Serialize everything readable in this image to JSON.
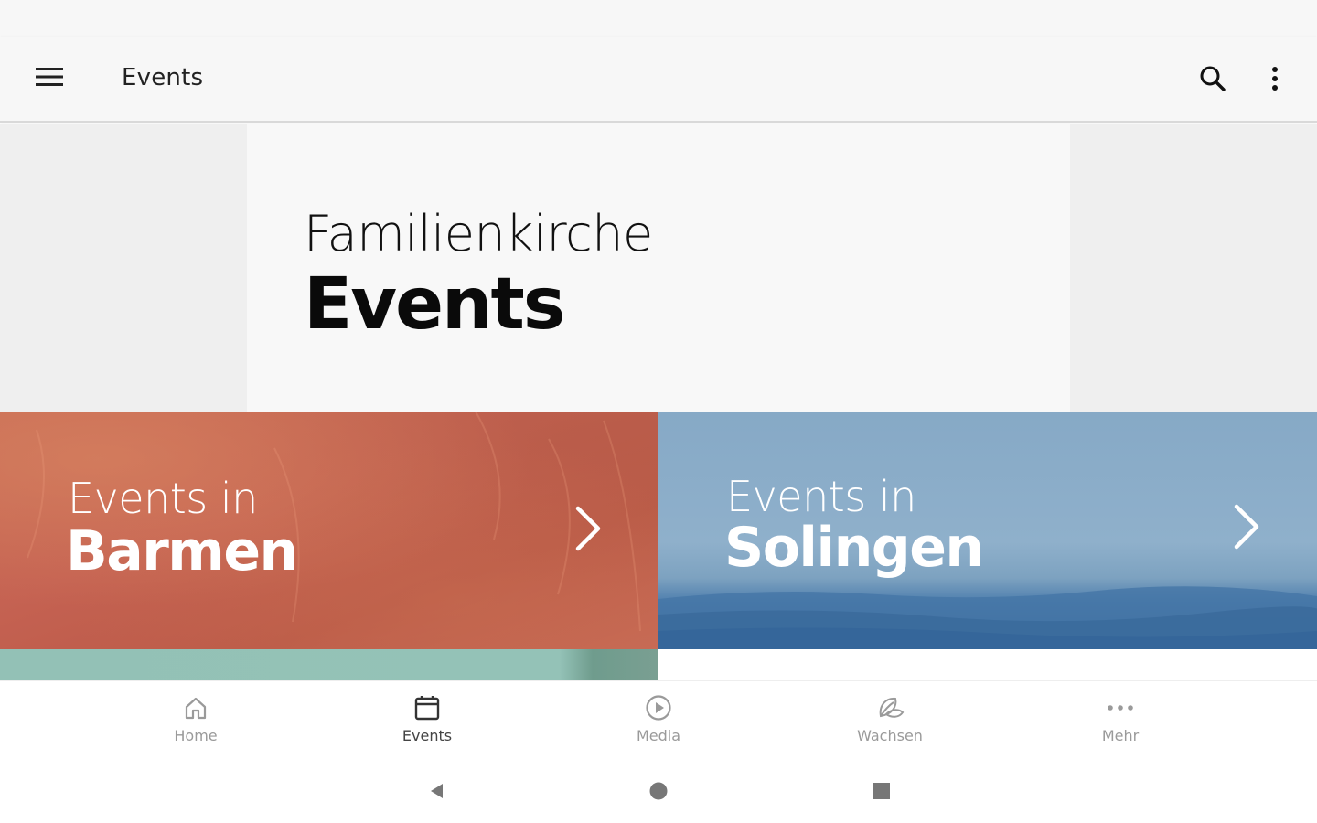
{
  "app_bar": {
    "title": "Events"
  },
  "hero": {
    "subtitle": "Familienkirche",
    "title": "Events"
  },
  "tiles": [
    {
      "line1": "Events in",
      "line2": "Barmen"
    },
    {
      "line1": "Events in",
      "line2": "Solingen"
    }
  ],
  "bottom_nav": {
    "items": [
      {
        "label": "Home",
        "icon": "home-icon",
        "active": false
      },
      {
        "label": "Events",
        "icon": "calendar-icon",
        "active": true
      },
      {
        "label": "Media",
        "icon": "play-circle-icon",
        "active": false
      },
      {
        "label": "Wachsen",
        "icon": "leaf-icon",
        "active": false
      },
      {
        "label": "Mehr",
        "icon": "more-horizontal-icon",
        "active": false
      }
    ]
  },
  "colors": {
    "barmen_tile": "#c5634f",
    "solingen_tile": "#86a9c6",
    "active_nav": "#444444",
    "inactive_nav": "#9a9a9a"
  }
}
